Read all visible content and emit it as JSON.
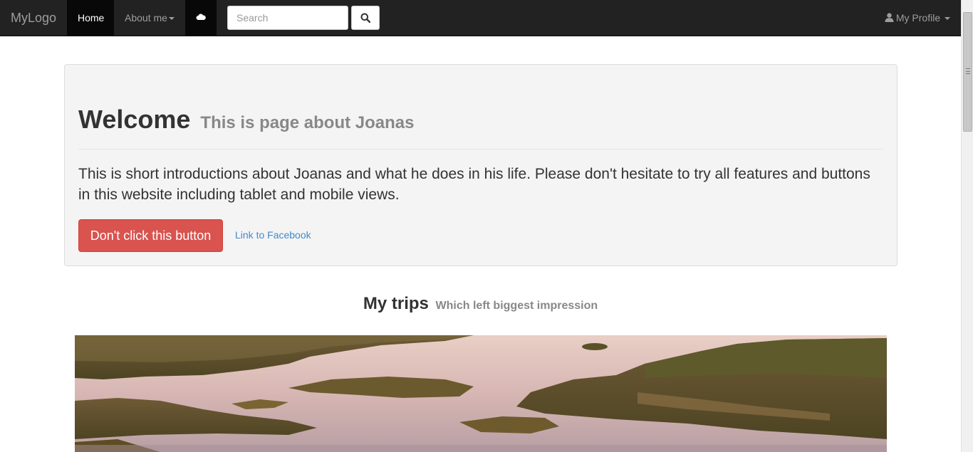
{
  "navbar": {
    "brand": "MyLogo",
    "home": "Home",
    "about": "About me",
    "search_placeholder": "Search",
    "profile": "My Profile"
  },
  "icons": {
    "cloud": "cloud-icon",
    "search": "search-icon",
    "user": "user-icon"
  },
  "jumbotron": {
    "title": "Welcome",
    "subtitle": "This is page about Joanas",
    "intro": "This is short introductions about Joanas and what he does in his life. Please don't hesitate to try all features and buttons in this website including tablet and mobile views.",
    "button_label": "Don't click this button",
    "link_label": "Link to Facebook"
  },
  "trips": {
    "title": "My trips",
    "subtitle": "Which left biggest impression"
  },
  "colors": {
    "navbar_bg": "#222222",
    "danger": "#d9534f",
    "link": "#428bca",
    "jumbotron_bg": "#f4f4f4"
  }
}
